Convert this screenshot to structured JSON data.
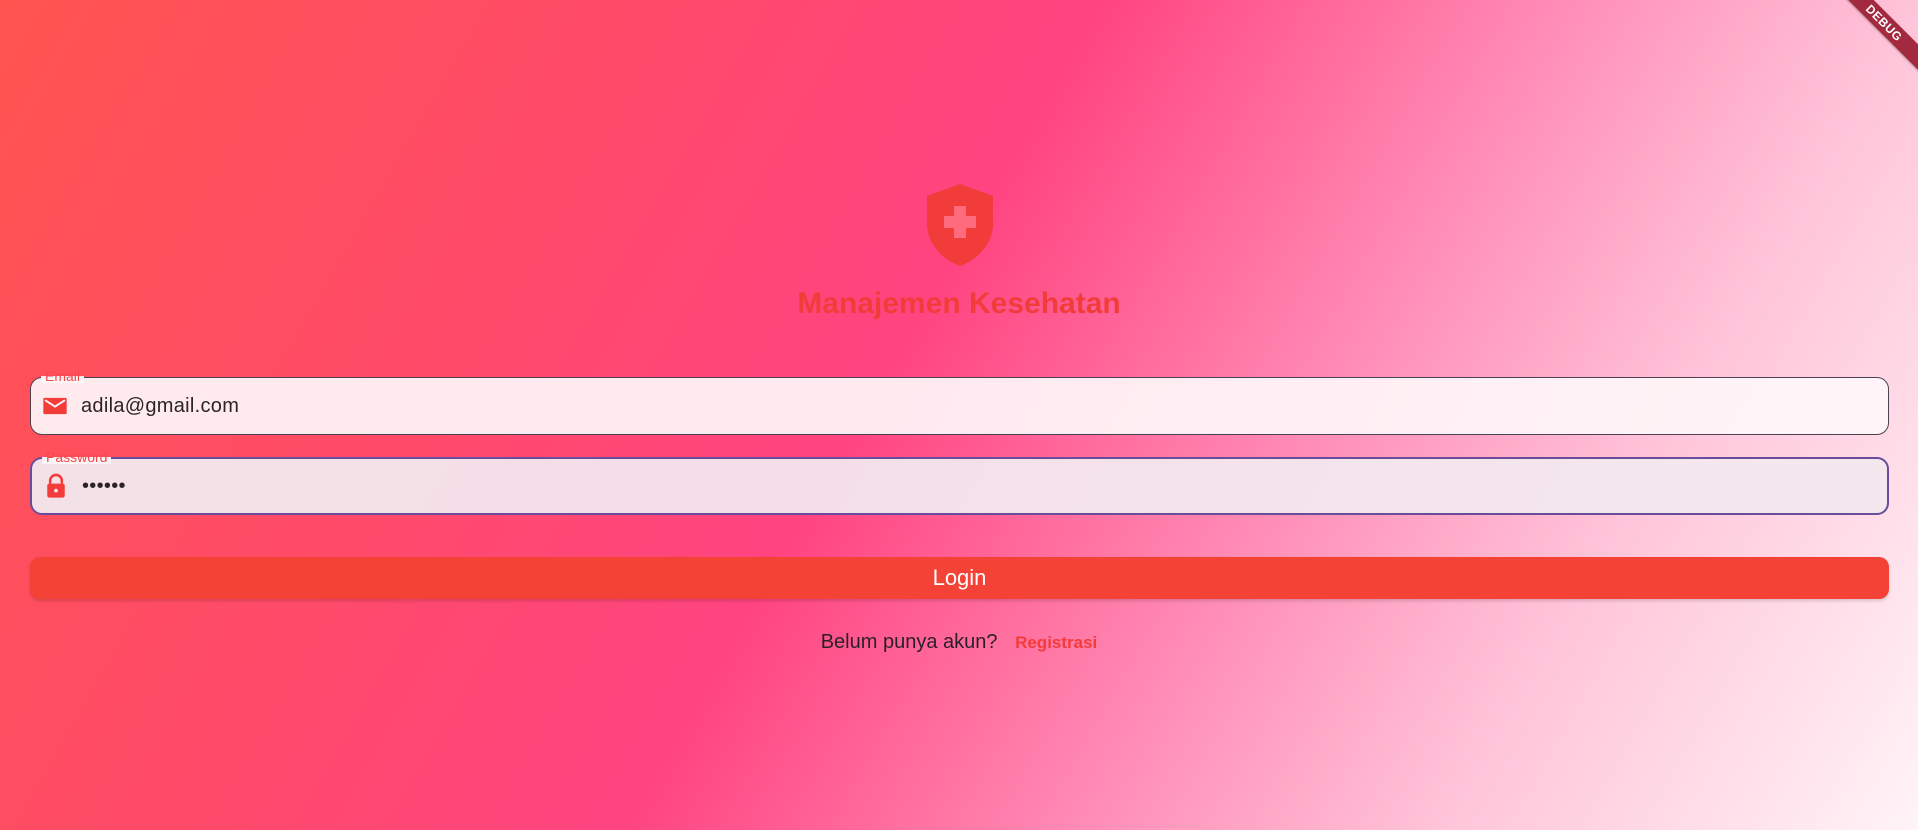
{
  "debug_banner": "DEBUG",
  "app": {
    "title": "Manajemen Kesehatan",
    "logo_icon": "shield-medical-icon"
  },
  "form": {
    "email": {
      "label": "Email",
      "value": "adila@gmail.com",
      "icon": "email-icon"
    },
    "password": {
      "label": "Password",
      "value": "••••••",
      "icon": "lock-icon"
    },
    "login_label": "Login"
  },
  "register": {
    "prompt": "Belum punya akun?",
    "link_label": "Registrasi"
  },
  "colors": {
    "accent": "#f23c3a",
    "button": "#f54236",
    "focus_border": "#6a4c9c"
  }
}
